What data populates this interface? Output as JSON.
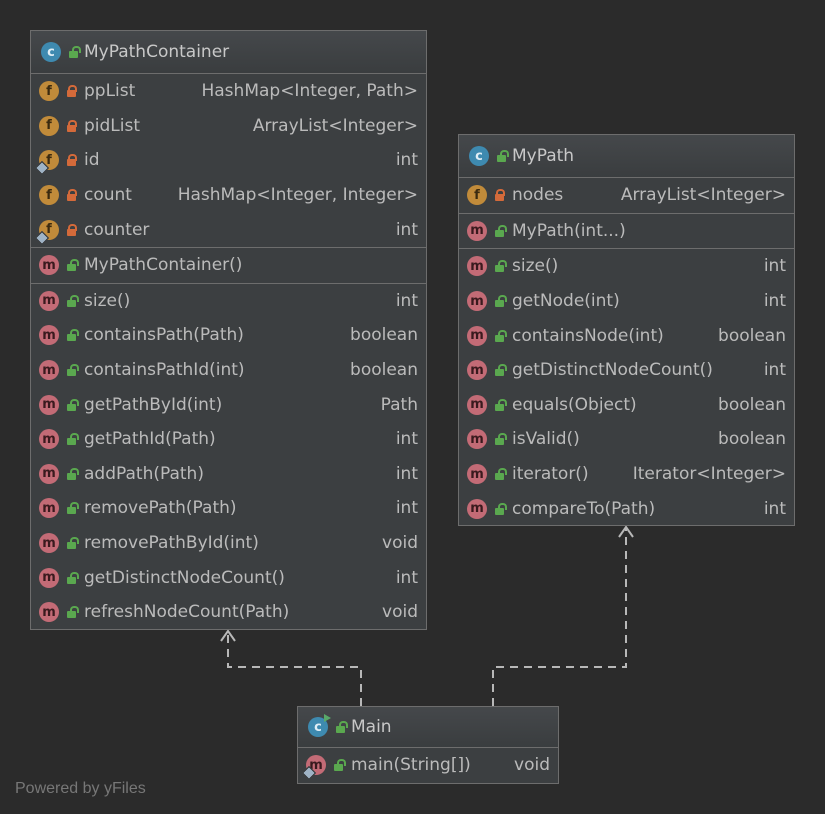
{
  "classes": {
    "container": {
      "name": "MyPathContainer",
      "fields": [
        {
          "name": "ppList",
          "type": "HashMap<Integer, Path>",
          "mini": false
        },
        {
          "name": "pidList",
          "type": "ArrayList<Integer>",
          "mini": false
        },
        {
          "name": "id",
          "type": "int",
          "mini": true
        },
        {
          "name": "count",
          "type": "HashMap<Integer, Integer>",
          "mini": false
        },
        {
          "name": "counter",
          "type": "int",
          "mini": true
        }
      ],
      "constructors": [
        {
          "name": "MyPathContainer()",
          "type": ""
        }
      ],
      "methods": [
        {
          "name": "size()",
          "type": "int"
        },
        {
          "name": "containsPath(Path)",
          "type": "boolean"
        },
        {
          "name": "containsPathId(int)",
          "type": "boolean"
        },
        {
          "name": "getPathById(int)",
          "type": "Path"
        },
        {
          "name": "getPathId(Path)",
          "type": "int"
        },
        {
          "name": "addPath(Path)",
          "type": "int"
        },
        {
          "name": "removePath(Path)",
          "type": "int"
        },
        {
          "name": "removePathById(int)",
          "type": "void"
        },
        {
          "name": "getDistinctNodeCount()",
          "type": "int"
        },
        {
          "name": "refreshNodeCount(Path)",
          "type": "void"
        }
      ]
    },
    "path": {
      "name": "MyPath",
      "fields": [
        {
          "name": "nodes",
          "type": "ArrayList<Integer>",
          "mini": false
        }
      ],
      "constructors": [
        {
          "name": "MyPath(int...)",
          "type": ""
        }
      ],
      "methods": [
        {
          "name": "size()",
          "type": "int"
        },
        {
          "name": "getNode(int)",
          "type": "int"
        },
        {
          "name": "containsNode(int)",
          "type": "boolean"
        },
        {
          "name": "getDistinctNodeCount()",
          "type": "int"
        },
        {
          "name": "equals(Object)",
          "type": "boolean"
        },
        {
          "name": "isValid()",
          "type": "boolean"
        },
        {
          "name": "iterator()",
          "type": "Iterator<Integer>"
        },
        {
          "name": "compareTo(Path)",
          "type": "int"
        }
      ]
    },
    "main": {
      "name": "Main",
      "methods": [
        {
          "name": "main(String[])",
          "type": "void",
          "mini": true
        }
      ]
    }
  },
  "icons": {
    "class_badge": "c",
    "field_badge": "f",
    "method_badge": "m",
    "private_icon": "lock-private",
    "public_icon": "lock-public"
  },
  "colors": {
    "background": "#2b2b2b",
    "box": "#3c3f41",
    "border": "#6d6d6d",
    "text": "#bbbbbb",
    "class_icon": "#3e8ab0",
    "field_icon": "#c18b3a",
    "method_icon": "#c36b76",
    "public": "#5aa84f",
    "private": "#d46a3a"
  },
  "watermark": "Powered by yFiles"
}
